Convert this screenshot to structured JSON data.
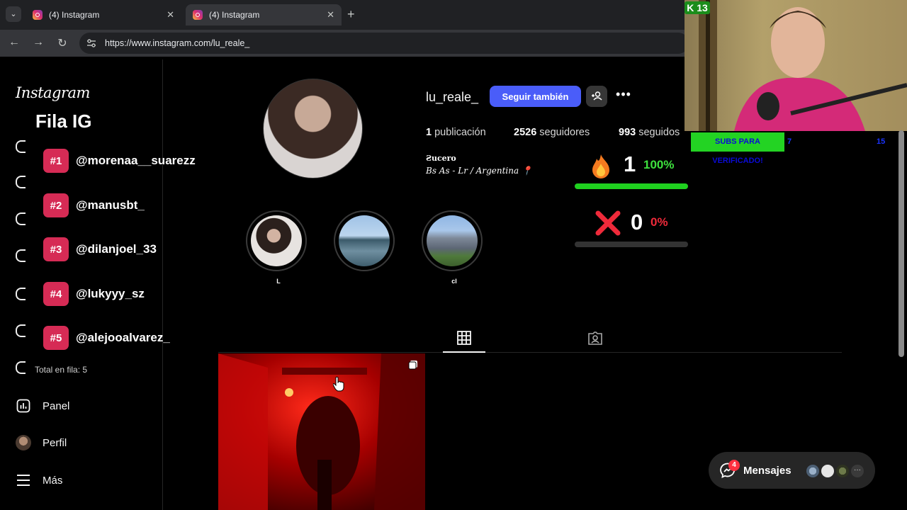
{
  "browser": {
    "tabs": [
      {
        "title": "(4) Instagram",
        "close": "✕"
      },
      {
        "title": "(4) Instagram",
        "close": "✕"
      }
    ],
    "new_tab": "+",
    "url": "https://www.instagram.com/lu_reale_"
  },
  "sidebar": {
    "logo": "Instagram",
    "items": [
      {
        "label": "Panel",
        "icon": "chart-icon"
      },
      {
        "label": "Perfil",
        "icon": "avatar"
      },
      {
        "label": "Más",
        "icon": "menu-icon"
      }
    ]
  },
  "queue": {
    "title": "Fila IG",
    "items": [
      {
        "rank": "#1",
        "handle": "@morenaa__suarezz"
      },
      {
        "rank": "#2",
        "handle": "@manusbt_"
      },
      {
        "rank": "#3",
        "handle": "@dilanjoel_33"
      },
      {
        "rank": "#4",
        "handle": "@lukyyy_sz"
      },
      {
        "rank": "#5",
        "handle": "@alejooalvarez_"
      }
    ],
    "total": "Total en fila: 5"
  },
  "profile": {
    "username": "lu_reale_",
    "follow_label": "Seguir también",
    "more": "•••",
    "stats": {
      "posts_num": "1",
      "posts_label": "publicación",
      "followers_num": "2526",
      "followers_label": "seguidores",
      "following_num": "993",
      "following_label": "seguidos"
    },
    "bio_name": "Ƨucero",
    "bio_line": "Bs As - Lr / Argentina 📍",
    "highlights": [
      {
        "label": "L"
      },
      {
        "label": ""
      },
      {
        "label": "cl"
      }
    ]
  },
  "counter": {
    "wins": "1",
    "wins_pct": "100%",
    "wins_fraction": 1.0,
    "losses": "0",
    "losses_pct": "0%",
    "losses_fraction": 0.0,
    "colors": {
      "win": "#1fd11f",
      "loss": "#ef2a3a"
    }
  },
  "stream": {
    "badge": "K 13",
    "subs_banner": "SUBS PARA VERIFICADO!",
    "subs_current": "7",
    "subs_goal": "15"
  },
  "messages": {
    "label": "Mensajes",
    "badge": "4",
    "more": "···"
  }
}
